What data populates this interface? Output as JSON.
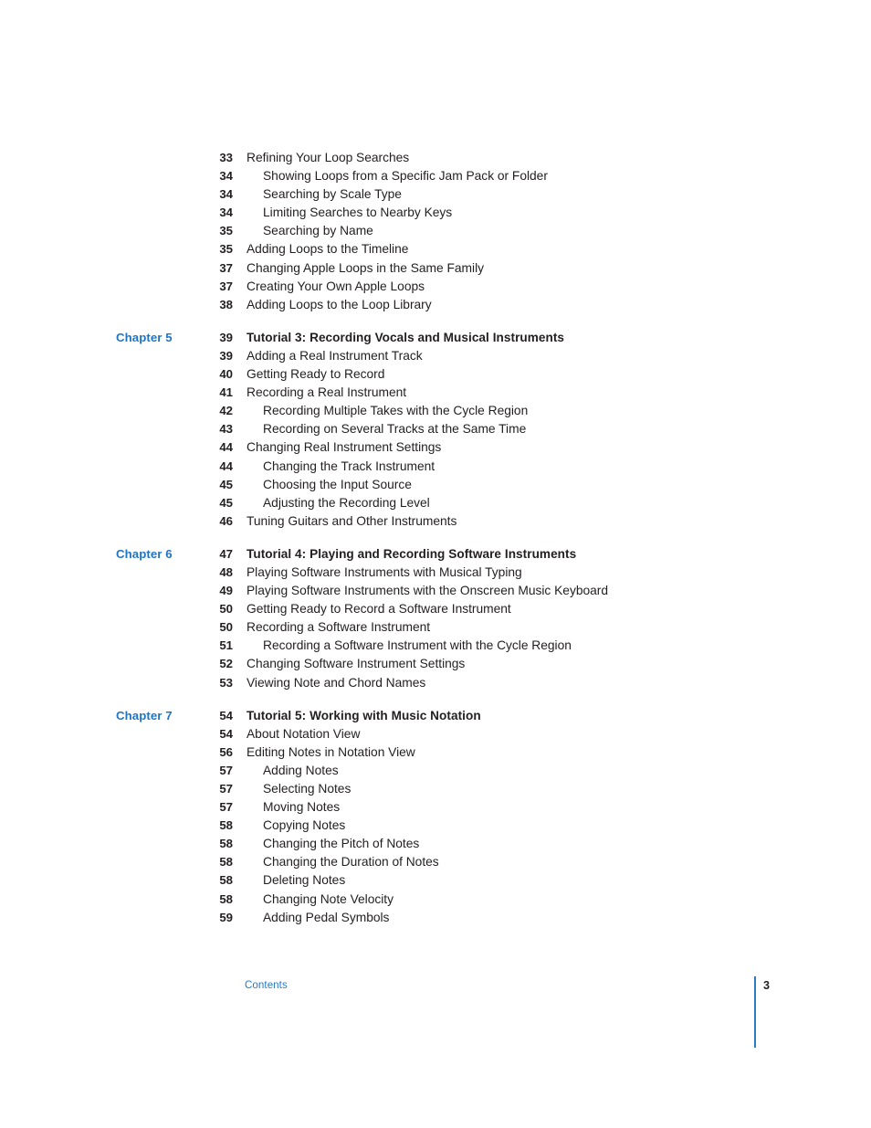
{
  "document": {
    "page_number": "3",
    "footer_label": "Contents",
    "accent_color": "#1f74c4",
    "footer_accent_color": "#2a7ac4",
    "text_color": "#231f20"
  },
  "toc": {
    "sections": [
      {
        "chapter_label": "",
        "entries": [
          {
            "page": "33",
            "text": "Refining Your Loop Searches",
            "level": 1,
            "title": false
          },
          {
            "page": "34",
            "text": "Showing Loops from a Specific Jam Pack or Folder",
            "level": 2,
            "title": false
          },
          {
            "page": "34",
            "text": "Searching by Scale Type",
            "level": 2,
            "title": false
          },
          {
            "page": "34",
            "text": "Limiting Searches to Nearby Keys",
            "level": 2,
            "title": false
          },
          {
            "page": "35",
            "text": "Searching by Name",
            "level": 2,
            "title": false
          },
          {
            "page": "35",
            "text": "Adding Loops to the Timeline",
            "level": 1,
            "title": false
          },
          {
            "page": "37",
            "text": "Changing Apple Loops in the Same Family",
            "level": 1,
            "title": false
          },
          {
            "page": "37",
            "text": "Creating Your Own Apple Loops",
            "level": 1,
            "title": false
          },
          {
            "page": "38",
            "text": "Adding Loops to the Loop Library",
            "level": 1,
            "title": false
          }
        ]
      },
      {
        "chapter_label": "Chapter 5",
        "entries": [
          {
            "page": "39",
            "text": "Tutorial 3:  Recording Vocals and Musical Instruments",
            "level": 1,
            "title": true
          },
          {
            "page": "39",
            "text": "Adding a Real Instrument Track",
            "level": 1,
            "title": false
          },
          {
            "page": "40",
            "text": "Getting Ready to Record",
            "level": 1,
            "title": false
          },
          {
            "page": "41",
            "text": "Recording a Real Instrument",
            "level": 1,
            "title": false
          },
          {
            "page": "42",
            "text": "Recording Multiple Takes with the Cycle Region",
            "level": 2,
            "title": false
          },
          {
            "page": "43",
            "text": "Recording on Several Tracks at the Same Time",
            "level": 2,
            "title": false
          },
          {
            "page": "44",
            "text": "Changing Real Instrument Settings",
            "level": 1,
            "title": false
          },
          {
            "page": "44",
            "text": "Changing the Track Instrument",
            "level": 2,
            "title": false
          },
          {
            "page": "45",
            "text": "Choosing the Input Source",
            "level": 2,
            "title": false
          },
          {
            "page": "45",
            "text": "Adjusting the Recording Level",
            "level": 2,
            "title": false
          },
          {
            "page": "46",
            "text": "Tuning Guitars and Other Instruments",
            "level": 1,
            "title": false
          }
        ]
      },
      {
        "chapter_label": "Chapter 6",
        "entries": [
          {
            "page": "47",
            "text": "Tutorial 4:  Playing and Recording Software Instruments",
            "level": 1,
            "title": true
          },
          {
            "page": "48",
            "text": "Playing Software Instruments with Musical Typing",
            "level": 1,
            "title": false
          },
          {
            "page": "49",
            "text": "Playing Software Instruments with the Onscreen Music Keyboard",
            "level": 1,
            "title": false
          },
          {
            "page": "50",
            "text": "Getting Ready to Record a Software Instrument",
            "level": 1,
            "title": false
          },
          {
            "page": "50",
            "text": "Recording a Software Instrument",
            "level": 1,
            "title": false
          },
          {
            "page": "51",
            "text": "Recording a Software Instrument with the Cycle Region",
            "level": 2,
            "title": false
          },
          {
            "page": "52",
            "text": "Changing Software Instrument Settings",
            "level": 1,
            "title": false
          },
          {
            "page": "53",
            "text": "Viewing Note and Chord Names",
            "level": 1,
            "title": false
          }
        ]
      },
      {
        "chapter_label": "Chapter 7",
        "entries": [
          {
            "page": "54",
            "text": "Tutorial 5: Working with Music Notation",
            "level": 1,
            "title": true
          },
          {
            "page": "54",
            "text": "About Notation View",
            "level": 1,
            "title": false
          },
          {
            "page": "56",
            "text": "Editing Notes in Notation View",
            "level": 1,
            "title": false
          },
          {
            "page": "57",
            "text": "Adding Notes",
            "level": 2,
            "title": false
          },
          {
            "page": "57",
            "text": "Selecting Notes",
            "level": 2,
            "title": false
          },
          {
            "page": "57",
            "text": "Moving Notes",
            "level": 2,
            "title": false
          },
          {
            "page": "58",
            "text": "Copying Notes",
            "level": 2,
            "title": false
          },
          {
            "page": "58",
            "text": "Changing the Pitch of Notes",
            "level": 2,
            "title": false
          },
          {
            "page": "58",
            "text": "Changing the Duration of Notes",
            "level": 2,
            "title": false
          },
          {
            "page": "58",
            "text": "Deleting Notes",
            "level": 2,
            "title": false
          },
          {
            "page": "58",
            "text": "Changing Note Velocity",
            "level": 2,
            "title": false
          },
          {
            "page": "59",
            "text": "Adding Pedal Symbols",
            "level": 2,
            "title": false
          }
        ]
      }
    ]
  }
}
